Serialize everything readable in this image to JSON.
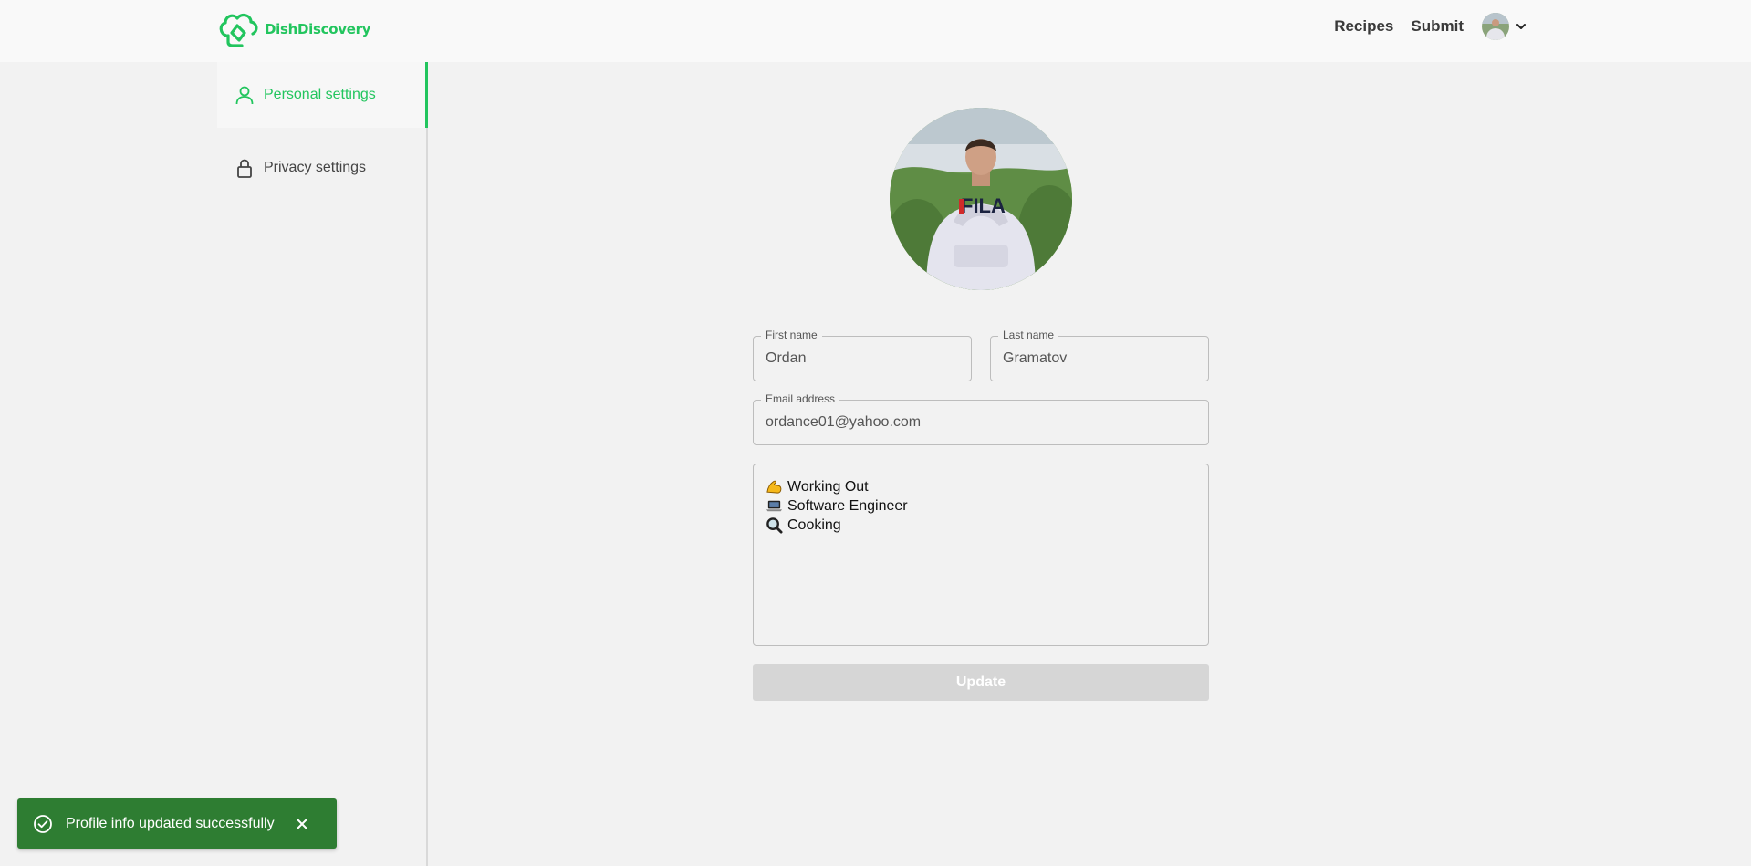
{
  "app": {
    "brand": "DishDiscovery",
    "accent_color": "#22c55e"
  },
  "header": {
    "nav": {
      "recipes": "Recipes",
      "submit": "Submit"
    },
    "user_menu_icon": "chevron-down-icon"
  },
  "sidebar": {
    "items": [
      {
        "label": "Personal settings",
        "icon": "user-icon",
        "active": true
      },
      {
        "label": "Privacy settings",
        "icon": "lock-icon",
        "active": false
      }
    ]
  },
  "form": {
    "first_name": {
      "label": "First name",
      "value": "Ordan"
    },
    "last_name": {
      "label": "Last name",
      "value": "Gramatov"
    },
    "email": {
      "label": "Email address",
      "value": "ordance01@yahoo.com"
    },
    "bio": [
      {
        "emoji": "flexed-biceps-icon",
        "text": "Working Out"
      },
      {
        "emoji": "laptop-icon",
        "text": "Software Engineer"
      },
      {
        "emoji": "magnifier-icon",
        "text": "Cooking"
      }
    ],
    "update_label": "Update"
  },
  "toast": {
    "message": "Profile info updated successfully",
    "status_color": "#2e7d32"
  }
}
